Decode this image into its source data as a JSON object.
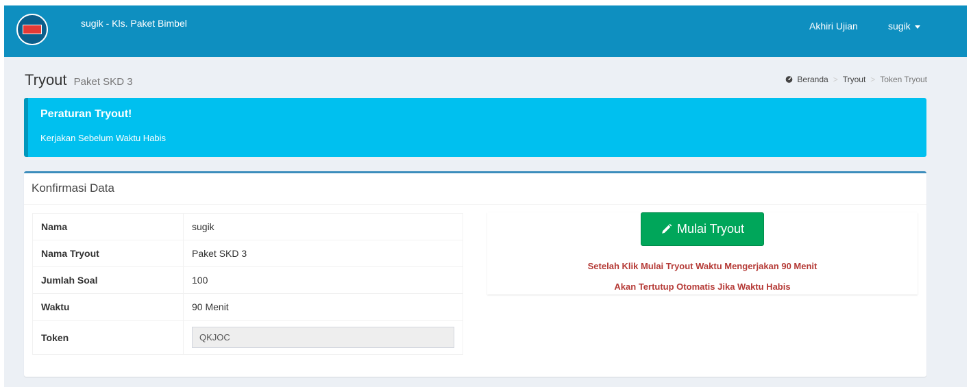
{
  "header": {
    "app_title": "sugik - Kls. Paket Bimbel",
    "end_exam_label": "Akhiri Ujian",
    "user_label": "sugik"
  },
  "page": {
    "title": "Tryout",
    "subtitle": "Paket SKD 3"
  },
  "breadcrumb": {
    "home": "Beranda",
    "tryout": "Tryout",
    "current": "Token Tryout"
  },
  "callout": {
    "title": "Peraturan Tryout!",
    "text": "Kerjakan Sebelum Waktu Habis"
  },
  "box": {
    "title": "Konfirmasi Data"
  },
  "table": {
    "rows": [
      {
        "label": "Nama",
        "value": "sugik"
      },
      {
        "label": "Nama Tryout",
        "value": "Paket SKD 3"
      },
      {
        "label": "Jumlah Soal",
        "value": "100"
      },
      {
        "label": "Waktu",
        "value": "90 Menit"
      }
    ],
    "token": {
      "label": "Token",
      "value": "QKJOC"
    }
  },
  "action": {
    "start_button": "Mulai Tryout",
    "warning_1": "Setelah Klik Mulai Tryout Waktu Mengerjakan 90 Menit",
    "warning_2": "Akan Tertutup Otomatis Jika Waktu Habis"
  },
  "colors": {
    "navbar": "#0e8fc0",
    "callout": "#00c0ef",
    "start_button": "#00a65a",
    "warning_text": "#b53a36"
  },
  "icons": {
    "logo": "logo-icon",
    "breadcrumb_home": "dashboard-icon",
    "start_button": "pencil-icon",
    "user_menu": "caret-down-icon"
  }
}
